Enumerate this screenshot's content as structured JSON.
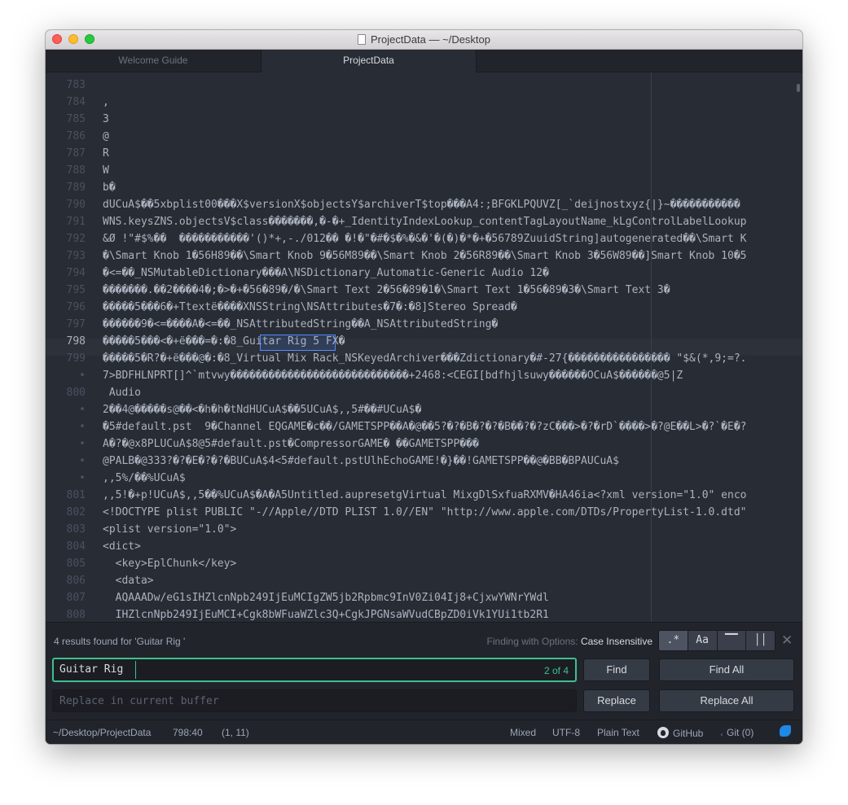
{
  "window": {
    "title": "ProjectData — ~/Desktop"
  },
  "tabs": [
    {
      "label": "Welcome Guide",
      "active": false
    },
    {
      "label": "ProjectData",
      "active": true
    }
  ],
  "editor": {
    "active_line_number": "798",
    "lines": [
      {
        "num": "783",
        "text": ""
      },
      {
        "num": "784",
        "text": ","
      },
      {
        "num": "785",
        "text": "3"
      },
      {
        "num": "786",
        "text": "@"
      },
      {
        "num": "787",
        "text": "R"
      },
      {
        "num": "788",
        "text": "W"
      },
      {
        "num": "789",
        "text": "b�"
      },
      {
        "num": "790",
        "text": "dUCuA$��5xbplist00���X$versionX$objectsY$archiverT$top���A4:;BFGKLPQUVZ[_`deijnostxyz{|}~�����������"
      },
      {
        "num": "791",
        "text": "WNS.keysZNS.objectsV$class�������,�-�+_IdentityIndexLookup_contentTagLayoutName_kLgControlLabelLookup"
      },
      {
        "num": "792",
        "text": "&Ø !\"#$%��  �����������'()*+,-./012�� �!�\"�#�$�%�&�'�(�)�*�+�56789ZuuidString]autogenerated��\\Smart K"
      },
      {
        "num": "793",
        "text": "�\\Smart Knob 1�56H89��\\Smart Knob 9�56M89��\\Smart Knob 2�56R89��\\Smart Knob 3�56W89��]Smart Knob 10�5"
      },
      {
        "num": "794",
        "text": "�<=��_NSMutableDictionary���A\\NSDictionary_Automatic-Generic Audio 12�"
      },
      {
        "num": "795",
        "text": "�������.��2����4�;�>�+�56�89�/�\\Smart Text 2�56�89�1�\\Smart Text 1�56�89�3�\\Smart Text 3�"
      },
      {
        "num": "796",
        "text": "�����5���6�+Ttextë����XNSString\\NSAttributes�7�:�8]Stereo Spread�"
      },
      {
        "num": "797",
        "text": "������9�<=����A�<=��_NSAttributedString��A_NSAttributedString�"
      },
      {
        "num": "798",
        "text": "�����5���<�+ë���=�:�8_Guitar Rig 5 FX�"
      },
      {
        "num": "799",
        "text": "�����5�R?�+ë���@�:�8_Virtual Mix Rack_NSKeyedArchiver���Zdictionary�#-27{���������������� \"$&(*,9;=?."
      },
      {
        "num": "•",
        "text": "7>BDFHLNPRT[]^`mtvwy����������������������������+2468:<CEGI[bdfhjlsuwy������OCuA$������@5|Z"
      },
      {
        "num": "800",
        "text": " Audio"
      },
      {
        "num": "•",
        "text": "2��4@�����s@��<�h�h�tNdHUCuA$��5UCuA$,,5#��#UCuA$�"
      },
      {
        "num": "•",
        "text": "�5#default.pst  9�Channel EQGAME�c��/GAMETSPP��A�@��5?�?�B�?�?�B��?�?zC���>�?�rD`����>�?@E��L>�?`�E�?"
      },
      {
        "num": "•",
        "text": "A�?�@x8PLUCuA$8@5#default.pst�CompressorGAME� ��GAMETSPP���"
      },
      {
        "num": "•",
        "text": "@PALB�@333?�?�E�?�?�BUCuA$4<5#default.pstUlhEchoGAME!�}��!GAMETSPP��@�BB�BPAUCuA$"
      },
      {
        "num": "•",
        "text": ",,5%/��%UCuA$"
      },
      {
        "num": "801",
        "text": ",,5!�+p!UCuA$,,5��%UCuA$�A�A5Untitled.aupresetgVirtual MixgDlSxfuaRXMV�HA46ia<?xml version=\"1.0\" enco"
      },
      {
        "num": "802",
        "text": "<!DOCTYPE plist PUBLIC \"-//Apple//DTD PLIST 1.0//EN\" \"http://www.apple.com/DTDs/PropertyList-1.0.dtd\""
      },
      {
        "num": "803",
        "text": "<plist version=\"1.0\">"
      },
      {
        "num": "804",
        "text": "<dict>"
      },
      {
        "num": "805",
        "text": "  <key>EplChunk</key>"
      },
      {
        "num": "806",
        "text": "  <data>"
      },
      {
        "num": "807",
        "text": "  AQAAADw/eG1sIHZlcnNpb249IjEuMCIgZW5jb2Rpbmc9InV0Zi04Ij8+CjxwYWNrYWdl"
      },
      {
        "num": "808",
        "text": "  IHZlcnNpb249IjEuMCI+Cgk8bWFuaWZlc3Q+CgkJPGNsaWVudCBpZD0iVk1YUi1tb2R1"
      }
    ]
  },
  "find": {
    "info": "4 results found for 'Guitar Rig '",
    "options_label": "Finding with Options:",
    "options_value": "Case Insensitive",
    "options": [
      {
        "icon": "regex-icon",
        "glyph": ".*"
      },
      {
        "icon": "case-icon",
        "glyph": "Aa"
      },
      {
        "icon": "selection-icon",
        "glyph": "▔▔"
      },
      {
        "icon": "whole-word-icon",
        "glyph": "││"
      }
    ],
    "query": "Guitar Rig",
    "count": "2 of 4",
    "replace_placeholder": "Replace in current buffer",
    "find_label": "Find",
    "find_all_label": "Find All",
    "replace_label": "Replace",
    "replace_all_label": "Replace All",
    "close_glyph": "✕"
  },
  "status": {
    "path": "~/Desktop/ProjectData",
    "position": "798:40",
    "selection": "(1, 11)",
    "line_ending": "Mixed",
    "encoding": "UTF-8",
    "grammar": "Plain Text",
    "github": "GitHub",
    "git": "Git (0)"
  },
  "colors": {
    "accent_green": "#3fbf8f",
    "match_blue": "#528bff",
    "editor_bg": "#282c34"
  }
}
